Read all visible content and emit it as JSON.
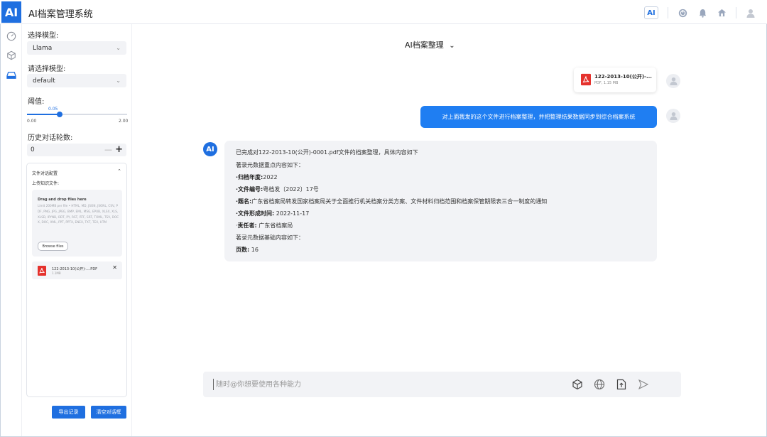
{
  "app": {
    "logo": "AI",
    "title": "AI档案管理系统"
  },
  "topbar": {
    "ai_badge": "AI",
    "icons": [
      "power-icon",
      "bell-icon",
      "home-icon",
      "user-icon"
    ]
  },
  "rail": {
    "icons": [
      "dashboard-icon",
      "cube-icon",
      "archive-icon"
    ]
  },
  "panel": {
    "model_label": "选择模型:",
    "model_value": "Llama",
    "model2_label": "请选择模型:",
    "model2_value": "default",
    "threshold_label": "阈值:",
    "threshold_value": "0.05",
    "threshold_min": "0.00",
    "threshold_max": "2.00",
    "threshold_fraction": 0.025,
    "history_label": "历史对话轮数:",
    "history_value": "0",
    "file_config": {
      "title": "文件对话配置",
      "upload_label": "上传知识文件:",
      "drop_title": "Drag and drop files here",
      "drop_limit": "Limit 200MB per file • HTML, MD, JSON, JSONL, CSV, PDF, PNG, JPG, JPEG, BMP, EML, MSG, EPUB, XLSX, XLS, XLSD, IPYNB, ODT, PY, RST, RTF, SRT, TOML, TSV, DOCX, DOC, XML, PPT, PPTX, ENEX, TXT, TEX, HTM",
      "browse_label": "Browse files",
      "file_name": "122-2013-10(公开)-....PDF",
      "file_size": "1.1MB"
    },
    "export_label": "导出记录",
    "clear_label": "清空对话框"
  },
  "chat": {
    "header": "AI档案整理",
    "file_card": {
      "name": "122-2013-10(公开)-...",
      "meta": "PDF, 1.15 MB"
    },
    "user_message": "对上面我发的这个文件进行档案整理，并把整理结果数据同步到综合档案系统",
    "ai_avatar": "AI",
    "ai_lines": {
      "intro": "已完成对122-2013-10(公开)-0001.pdf文件的档案整理，具体内容如下",
      "key_meta_head": "著录元数据重点内容如下：",
      "year_label": "·归档年度:",
      "year_value": "2022",
      "docno_label": "·文件编号:",
      "docno_value": "粤档发〔2022〕17号",
      "title_label": "·题名:",
      "title_value": "广东省档案局转发国家档案局关于全面推行机关档案分类方案、文件材料归档范围和档案保管期限表三合一制度的通知",
      "time_label": "·文件形成时间:",
      "time_value": " 2022-11-17",
      "resp_prefix": "·",
      "resp_label": "责任者:",
      "resp_value": " 广东省档案局",
      "basic_meta_head": "著录元数据基础内容如下：",
      "pages_label": "页数:",
      "pages_value": " 16"
    },
    "input_placeholder": "随时@你想要使用各种能力",
    "input_icons": [
      "cube-icon",
      "globe-icon",
      "file-upload-icon",
      "send-icon"
    ]
  },
  "colors": {
    "primary": "#1f6fe0",
    "bubble_user": "#1f7ef2",
    "bubble_ai": "#f2f3f6",
    "pdf_red": "#e5322d"
  }
}
